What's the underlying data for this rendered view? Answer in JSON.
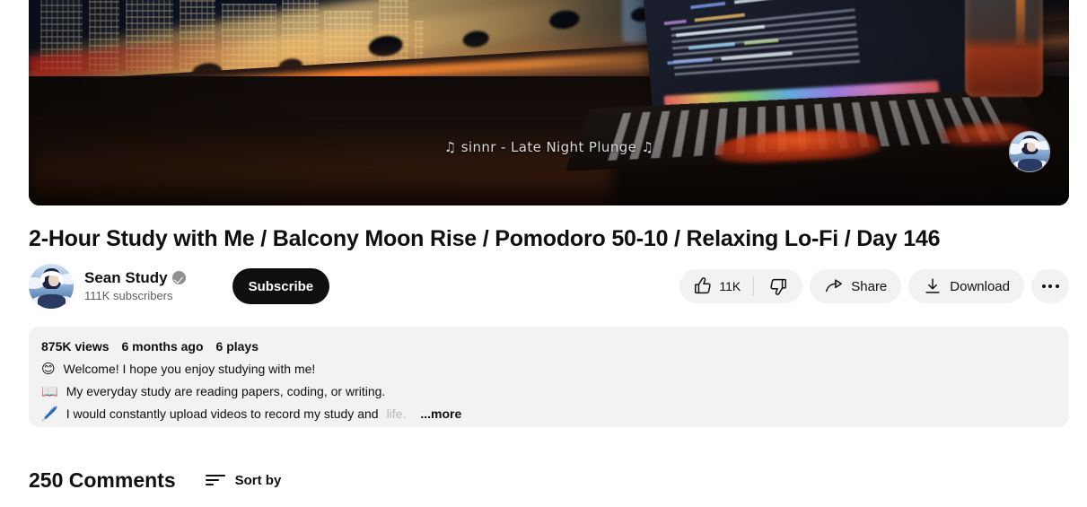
{
  "video": {
    "title": "2-Hour Study with Me / Balcony Moon Rise / Pomodoro 50-10 / Relaxing Lo-Fi / Day 146",
    "music_caption": "♫  sinnr - Late Night Plunge  ♫",
    "watermark": "channel-watermark-avatar"
  },
  "channel": {
    "name": "Sean Study",
    "verified_icon": "verified-badge-icon",
    "subscribers": "111K subscribers",
    "subscribe_label": "Subscribe",
    "avatar": "channel-avatar"
  },
  "actions": {
    "like_icon": "thumbs-up-icon",
    "like_count": "11K",
    "dislike_icon": "thumbs-down-icon",
    "share_icon": "share-arrow-icon",
    "share_label": "Share",
    "download_icon": "download-icon",
    "download_label": "Download",
    "more_icon": "more-horizontal-icon"
  },
  "description": {
    "views": "875K views",
    "published": "6 months ago",
    "plays": "6 plays",
    "lines": [
      {
        "emoji": "😊",
        "emoji_name": "smiling-face-emoji",
        "text": "Welcome! I hope you enjoy studying with me!"
      },
      {
        "emoji": "📖",
        "emoji_name": "open-book-emoji",
        "text": "My everyday study are reading papers, coding, or writing."
      },
      {
        "emoji": "🖊️",
        "emoji_name": "pen-emoji",
        "text": "I would constantly upload videos to record my study and "
      }
    ],
    "faded_tail": "life.",
    "more_label": "...more"
  },
  "comments": {
    "count_label": "250 Comments",
    "sort_icon": "sort-lines-icon",
    "sort_label": "Sort by"
  },
  "colors": {
    "text_primary": "#0f0f0f",
    "text_secondary": "#606060",
    "pill_background": "#f2f2f2",
    "subscribe_background": "#0f0f0f",
    "page_background": "#ffffff"
  }
}
